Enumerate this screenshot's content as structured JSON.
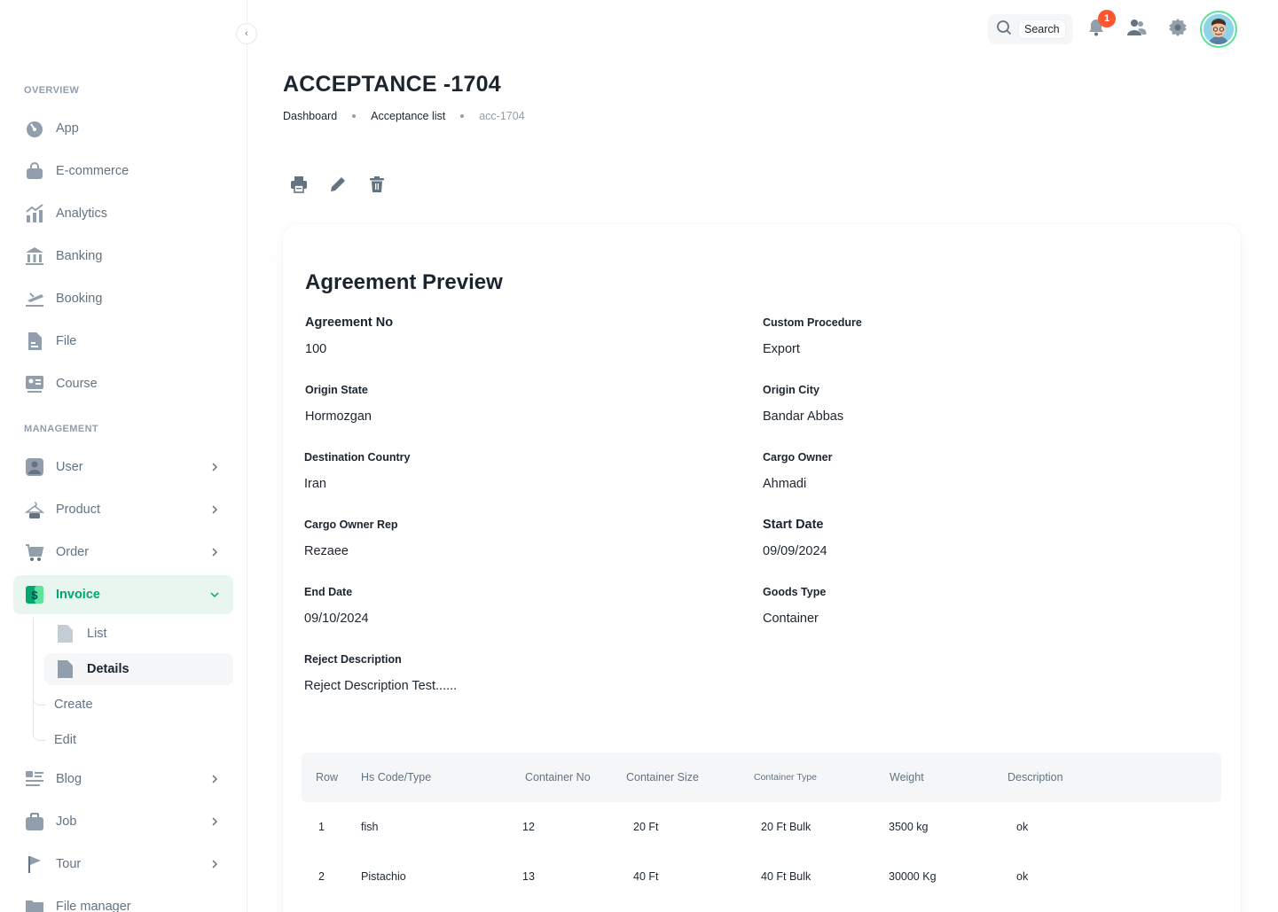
{
  "sidebar": {
    "sections": {
      "overview": "OVERVIEW",
      "management": "MANAGEMENT"
    },
    "overview_items": [
      {
        "label": "App",
        "icon": "app-icon"
      },
      {
        "label": "E-commerce",
        "icon": "shopping-bag-icon"
      },
      {
        "label": "Analytics",
        "icon": "analytics-icon"
      },
      {
        "label": "Banking",
        "icon": "bank-icon"
      },
      {
        "label": "Booking",
        "icon": "booking-icon"
      },
      {
        "label": "File",
        "icon": "file-icon"
      },
      {
        "label": "Course",
        "icon": "course-icon"
      }
    ],
    "management_items": [
      {
        "label": "User",
        "icon": "user-icon"
      },
      {
        "label": "Product",
        "icon": "product-icon"
      },
      {
        "label": "Order",
        "icon": "cart-icon"
      },
      {
        "label": "Invoice",
        "icon": "invoice-icon"
      },
      {
        "label": "Blog",
        "icon": "blog-icon"
      },
      {
        "label": "Job",
        "icon": "job-icon"
      },
      {
        "label": "Tour",
        "icon": "tour-icon"
      },
      {
        "label": "File manager",
        "icon": "folder-icon"
      }
    ],
    "invoice_sub": {
      "list": "List",
      "details": "Details",
      "create": "Create",
      "edit": "Edit"
    }
  },
  "header": {
    "search_label": "Search",
    "notification_count": "1"
  },
  "page": {
    "title": "ACCEPTANCE -1704",
    "breadcrumb": [
      "Dashboard",
      "Acceptance list",
      "acc-1704"
    ]
  },
  "card": {
    "title": "Agreement Preview",
    "fields": {
      "agreement_no": {
        "label": "Agreement No",
        "value": "100"
      },
      "custom_procedure": {
        "label": "Custom Procedure",
        "value": "Export"
      },
      "origin_state": {
        "label": "Origin State",
        "value": "Hormozgan"
      },
      "origin_city": {
        "label": "Origin City",
        "value": "Bandar Abbas"
      },
      "destination_country": {
        "label": "Destination Country",
        "value": "Iran"
      },
      "cargo_owner": {
        "label": "Cargo Owner",
        "value": "Ahmadi"
      },
      "cargo_owner_rep": {
        "label": "Cargo Owner Rep",
        "value": "Rezaee"
      },
      "start_date": {
        "label": "Start Date",
        "value": "09/09/2024"
      },
      "end_date": {
        "label": "End Date",
        "value": "09/10/2024"
      },
      "goods_type": {
        "label": "Goods Type",
        "value": "Container"
      },
      "reject_description": {
        "label": "Reject Description",
        "value": "Reject Description Test......"
      }
    },
    "table": {
      "headers": [
        "Row",
        "Hs Code/Type",
        "Container No",
        "Container Size",
        "Container Type",
        "Weight",
        "Description"
      ],
      "rows": [
        [
          "1",
          "fish",
          "12",
          "20 Ft",
          "20 Ft Bulk",
          "3500 kg",
          "ok"
        ],
        [
          "2",
          "Pistachio",
          "13",
          "40 Ft",
          "40 Ft Bulk",
          "30000 Kg",
          "ok"
        ]
      ]
    }
  },
  "colors": {
    "accent": "#00a76f",
    "accent_bg": "#e9f6ef",
    "badge": "#ff5630",
    "text_primary": "#1c252e",
    "text_secondary": "#637381"
  }
}
